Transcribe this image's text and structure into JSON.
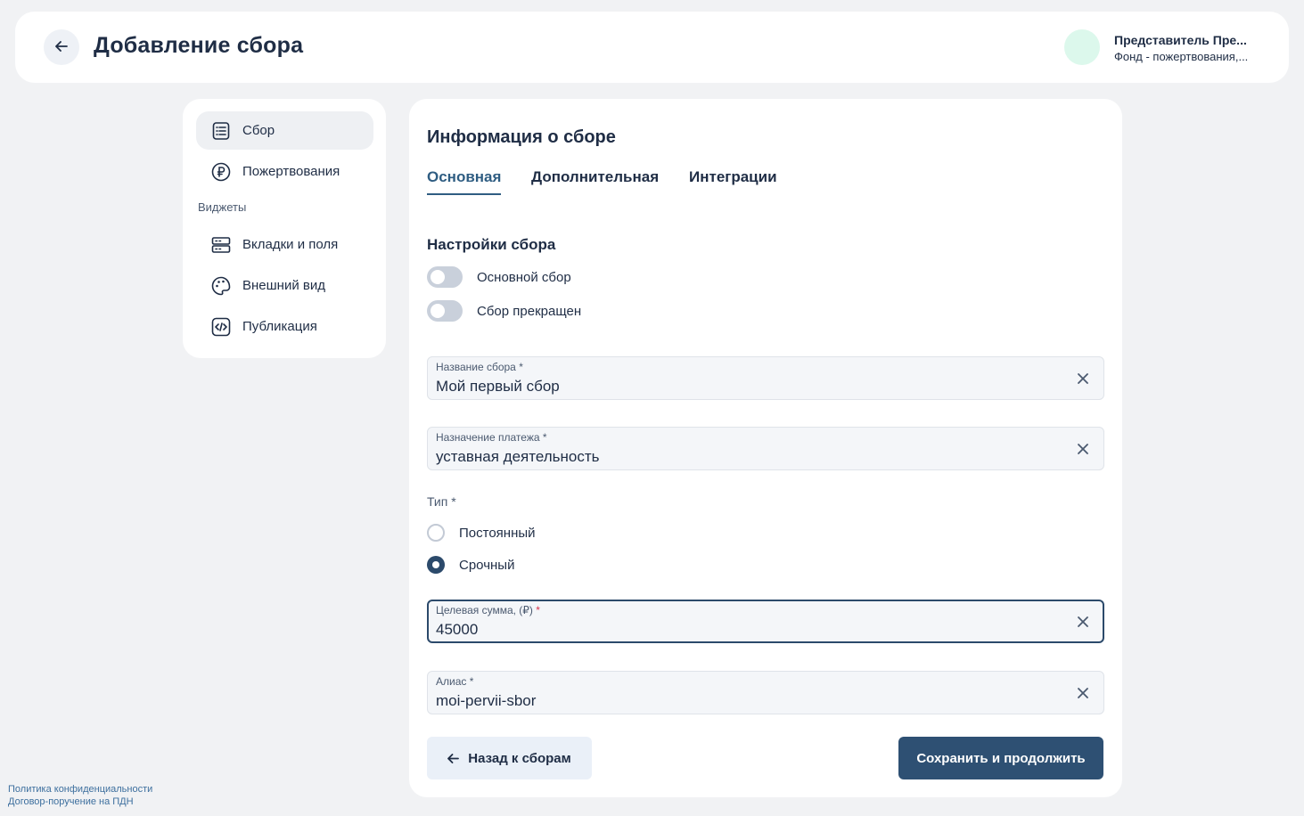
{
  "header": {
    "title": "Добавление сбора",
    "user_name": "Представитель Пре...",
    "user_org": "Фонд - пожертвования,..."
  },
  "sidebar": {
    "items": [
      {
        "label": "Сбор",
        "icon": "receipt-icon",
        "active": true
      },
      {
        "label": "Пожертвования",
        "icon": "ruble-icon",
        "active": false
      }
    ],
    "section_label": "Виджеты",
    "widget_items": [
      {
        "label": "Вкладки и поля",
        "icon": "tabs-fields-icon"
      },
      {
        "label": "Внешний вид",
        "icon": "palette-icon"
      },
      {
        "label": "Публикация",
        "icon": "code-icon"
      }
    ]
  },
  "main": {
    "title": "Информация о сборе",
    "tabs": [
      {
        "label": "Основная",
        "active": true
      },
      {
        "label": "Дополнительная",
        "active": false
      },
      {
        "label": "Интеграции",
        "active": false
      }
    ],
    "settings_title": "Настройки сбора",
    "toggles": [
      {
        "label": "Основной сбор",
        "on": false
      },
      {
        "label": "Сбор прекращен",
        "on": false
      }
    ],
    "fields": {
      "name": {
        "label": "Название сбора",
        "required": "*",
        "value": "Мой первый сбор"
      },
      "purpose": {
        "label": "Назначение платежа",
        "required": "*",
        "value": "уставная деятельность"
      },
      "target": {
        "label": "Целевая сумма, (₽)",
        "required": "*",
        "value": "45000"
      },
      "alias": {
        "label": "Алиас",
        "required": "*",
        "value": "moi-pervii-sbor"
      }
    },
    "type_label": "Тип *",
    "type_options": [
      {
        "label": "Постоянный",
        "checked": false
      },
      {
        "label": "Срочный",
        "checked": true
      }
    ],
    "back_button": "Назад к сборам",
    "save_button": "Сохранить и продолжить"
  },
  "footer": {
    "privacy": "Политика конфиденциальности",
    "agreement": "Договор-поручение на ПДН"
  },
  "colors": {
    "primary": "#2e5073",
    "active_tab": "#2f5d82",
    "text": "#1f2d45",
    "background": "#f1f2f4",
    "avatar": "#dcf8ec",
    "required_focus": "#d9324a"
  }
}
